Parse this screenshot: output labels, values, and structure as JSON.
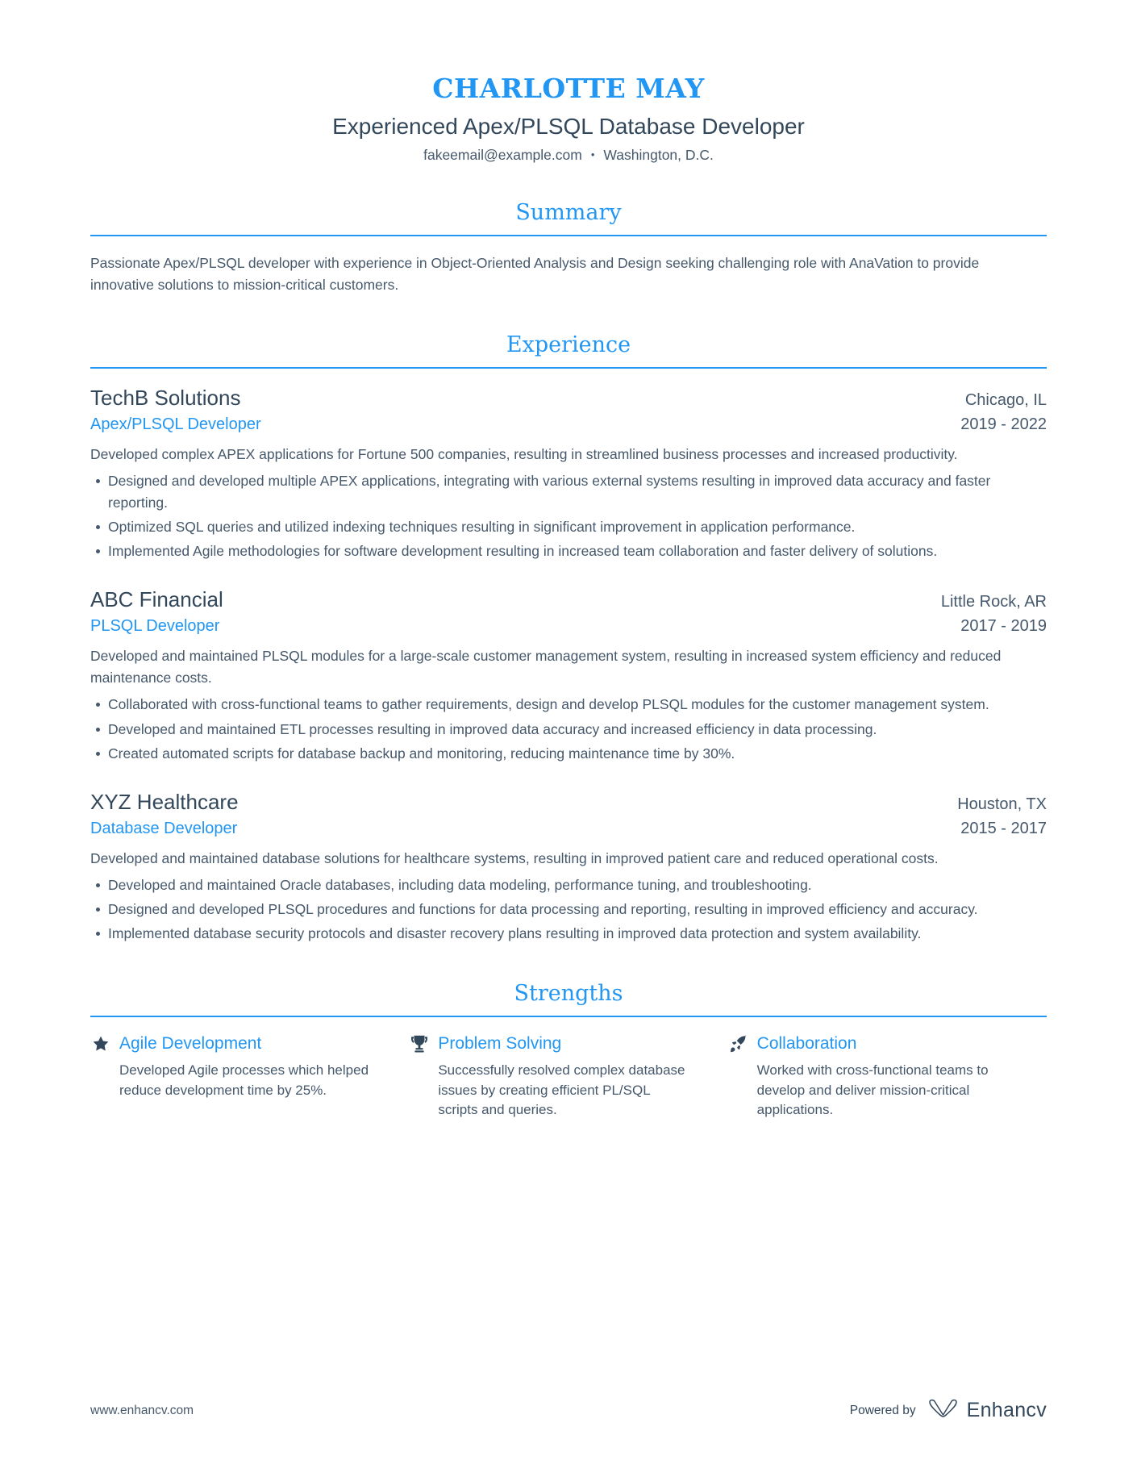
{
  "theme": {
    "accent": "#2196f3",
    "heading_color": "#33475b",
    "body_color": "#46586b",
    "page_background": "#ffffff"
  },
  "header": {
    "full_name": "CHARLOTTE MAY",
    "headline": "Experienced Apex/PLSQL Database Developer",
    "email": "fakeemail@example.com",
    "separator": "•",
    "location": "Washington, D.C."
  },
  "sections": {
    "summary": {
      "title": "Summary",
      "text": "Passionate Apex/PLSQL developer with experience in Object-Oriented Analysis and Design seeking challenging role with AnaVation to provide innovative solutions to mission-critical customers."
    },
    "experience": {
      "title": "Experience",
      "jobs": [
        {
          "company": "TechB Solutions",
          "location": "Chicago, IL",
          "title": "Apex/PLSQL Developer",
          "dates": "2019 - 2022",
          "description": "Developed complex APEX applications for Fortune 500 companies, resulting in streamlined business processes and increased productivity.",
          "bullets": [
            "Designed and developed multiple APEX applications, integrating with various external systems resulting in improved data accuracy and faster reporting.",
            "Optimized SQL queries and utilized indexing techniques resulting in significant improvement in application performance.",
            "Implemented Agile methodologies for software development resulting in increased team collaboration and faster delivery of solutions."
          ]
        },
        {
          "company": "ABC Financial",
          "location": "Little Rock, AR",
          "title": "PLSQL Developer",
          "dates": "2017 - 2019",
          "description": "Developed and maintained PLSQL modules for a large-scale customer management system, resulting in increased system efficiency and reduced maintenance costs.",
          "bullets": [
            "Collaborated with cross-functional teams to gather requirements, design and develop PLSQL modules for the customer management system.",
            "Developed and maintained ETL processes resulting in improved data accuracy and increased efficiency in data processing.",
            "Created automated scripts for database backup and monitoring, reducing maintenance time by 30%."
          ]
        },
        {
          "company": "XYZ Healthcare",
          "location": "Houston, TX",
          "title": "Database Developer",
          "dates": "2015 - 2017",
          "description": "Developed and maintained database solutions for healthcare systems, resulting in improved patient care and reduced operational costs.",
          "bullets": [
            "Developed and maintained Oracle databases, including data modeling, performance tuning, and troubleshooting.",
            "Designed and developed PLSQL procedures and functions for data processing and reporting, resulting in improved efficiency and accuracy.",
            "Implemented database security protocols and disaster recovery plans resulting in improved data protection and system availability."
          ]
        }
      ]
    },
    "strengths": {
      "title": "Strengths",
      "items": [
        {
          "icon": "star-icon",
          "name": "Agile Development",
          "description": "Developed Agile processes which helped reduce development time by 25%."
        },
        {
          "icon": "trophy-icon",
          "name": "Problem Solving",
          "description": "Successfully resolved complex database issues by creating efficient PL/SQL scripts and queries."
        },
        {
          "icon": "rocket-icon",
          "name": "Collaboration",
          "description": "Worked with cross-functional teams to develop and deliver mission-critical applications."
        }
      ]
    }
  },
  "footer": {
    "url": "www.enhancv.com",
    "powered_by": "Powered by",
    "brand_name": "Enhancv"
  }
}
